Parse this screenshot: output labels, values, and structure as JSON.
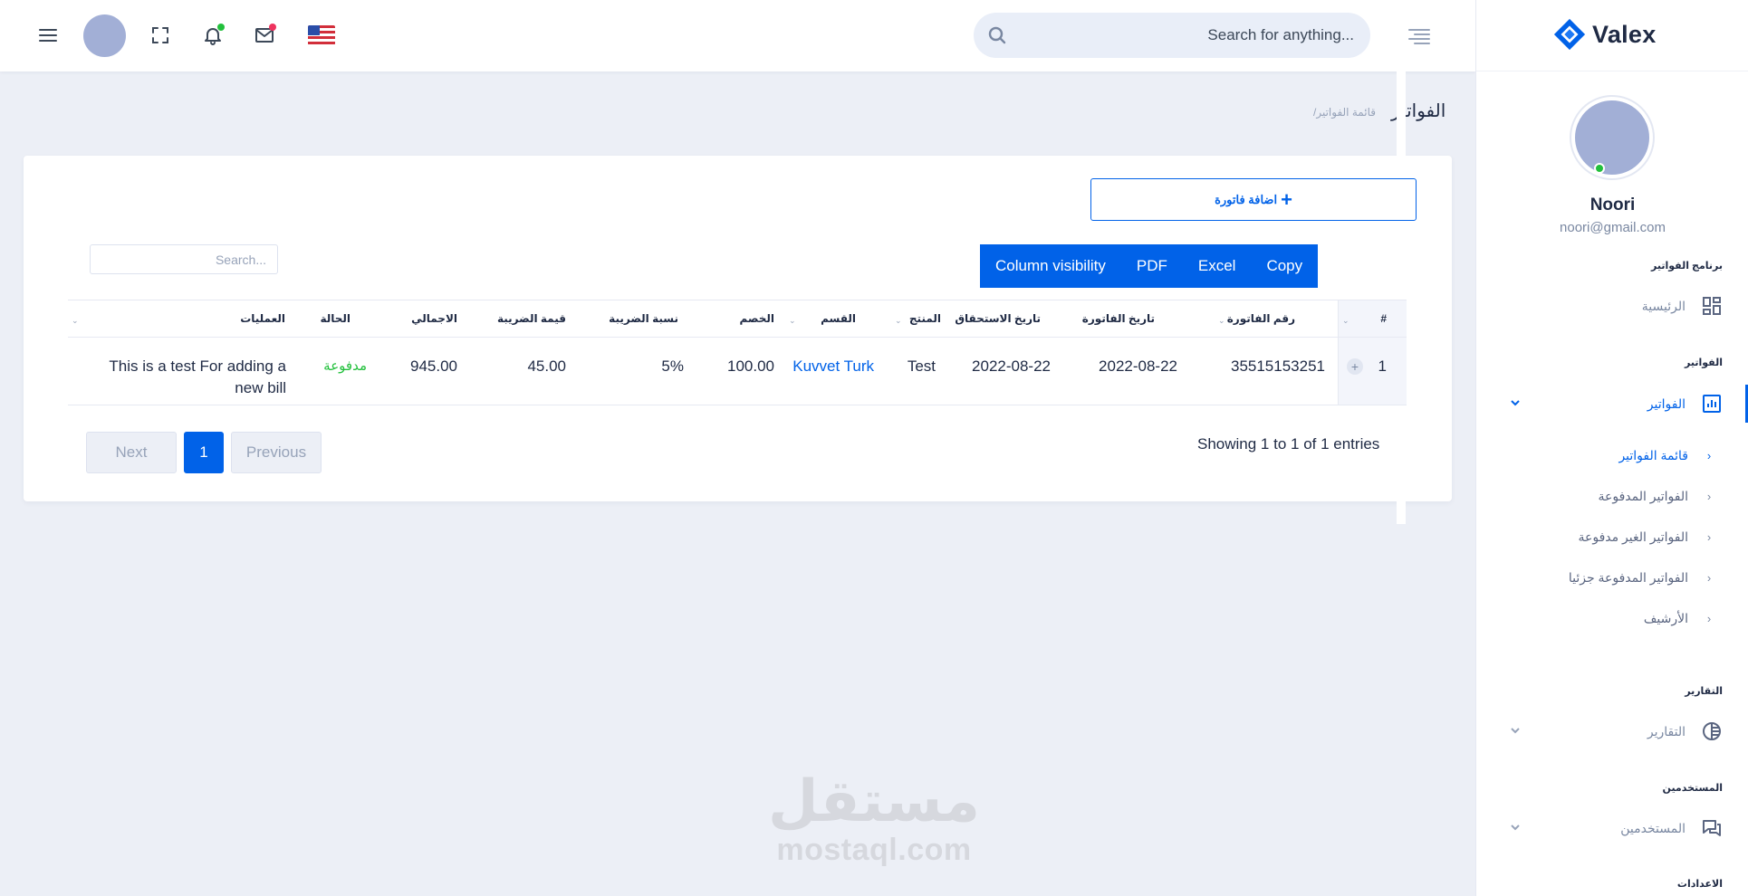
{
  "header": {
    "search_placeholder": "Search for anything...",
    "icons": [
      "menu-icon",
      "fullscreen-icon",
      "bell-icon",
      "mail-icon",
      "us-flag-icon",
      "search-icon",
      "align-right-icon"
    ]
  },
  "sidebar": {
    "logo_text": "Valex",
    "user_name": "Noori",
    "user_email": "noori@gmail.com",
    "sections": {
      "program": "برنامج الفواتير",
      "invoices": "الفواتير",
      "reports": "التقارير",
      "users": "المستخدمين",
      "settings": "الاعدادات"
    },
    "items": {
      "home": "الرئيسية",
      "invoices": "الفواتير",
      "reports": "التقارير",
      "users": "المستخدمين"
    },
    "submenu": [
      "قائمة الفواتير",
      "الفواتير المدفوعة",
      "الفواتير الغير مدفوعة",
      "الفواتير المدفوعة جزئيا",
      "الأرشيف"
    ]
  },
  "breadcrumb": {
    "title": "الفواتير",
    "current": "/قائمة الفواتير"
  },
  "actions": {
    "add_invoice": "اضافة فاتورة",
    "copy": "Copy",
    "excel": "Excel",
    "pdf": "PDF",
    "column_visibility": "Column visibility",
    "table_search_placeholder": "Search..."
  },
  "table": {
    "headers": {
      "hash": "#",
      "number": "رقم الفاتورة",
      "date": "تاريخ الفاتورة",
      "due": "تاريخ الاستحقاق",
      "product": "المنتج",
      "section": "القسم",
      "discount": "الخصم",
      "tax_rate": "نسبة الضريبة",
      "tax_value": "قيمة الضريبة",
      "total": "الاجمالي",
      "status": "الحالة",
      "operations": "العمليات"
    },
    "rows": [
      {
        "hash": "1",
        "number": "35515153251",
        "date": "2022-08-22",
        "due": "2022-08-22",
        "product": "Test",
        "section": "Kuvvet Turk",
        "discount": "100.00",
        "tax_rate": "5%",
        "tax_value": "45.00",
        "total": "945.00",
        "status": "مدفوعة",
        "operations_line1": "This is a test For adding a",
        "operations_line2": "new bill"
      }
    ]
  },
  "pagination": {
    "info": "Showing 1 to 1 of 1 entries",
    "previous": "Previous",
    "current": "1",
    "next": "Next"
  },
  "watermark": {
    "arabic": "مستقل",
    "latin": "mostaql.com"
  },
  "colors": {
    "primary": "#0162e8",
    "success": "#22c03c",
    "danger": "#ee335e",
    "background": "#eceff6"
  }
}
